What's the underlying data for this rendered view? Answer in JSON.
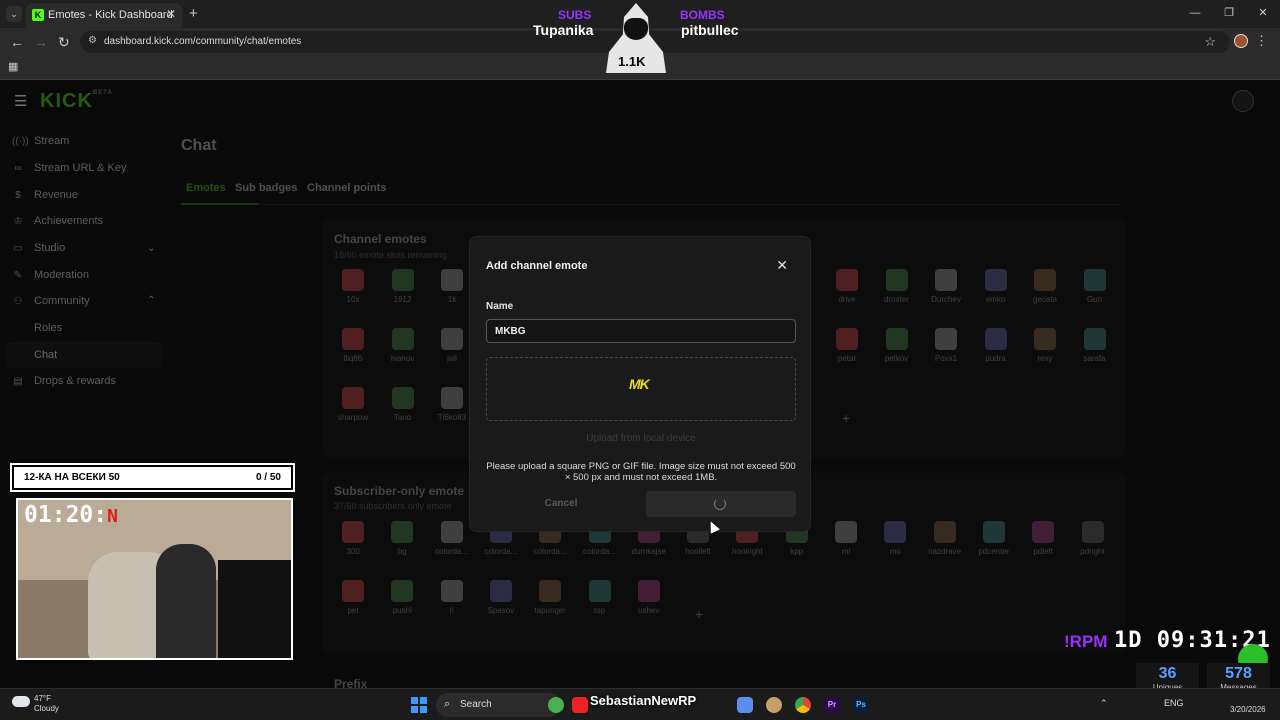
{
  "browser": {
    "tab_title": "Emotes - Kick Dashboard",
    "tab_favicon": "K",
    "url": "dashboard.kick.com/community/chat/emotes"
  },
  "app": {
    "logo": "KICK",
    "logo_badge": "BETA"
  },
  "sidebar": {
    "items": [
      {
        "label": "Stream",
        "icon": "broadcast-icon"
      },
      {
        "label": "Stream URL & Key",
        "icon": "link-icon"
      },
      {
        "label": "Revenue",
        "icon": "dollar-icon"
      },
      {
        "label": "Achievements",
        "icon": "trophy-icon"
      },
      {
        "label": "Studio",
        "icon": "studio-icon"
      },
      {
        "label": "Moderation",
        "icon": "wrench-icon"
      },
      {
        "label": "Community",
        "icon": "community-icon"
      }
    ],
    "community_sub": [
      "Roles",
      "Chat"
    ],
    "drops": "Drops & rewards"
  },
  "main": {
    "title": "Chat",
    "tabs": [
      "Emotes",
      "Sub badges",
      "Channel points"
    ],
    "channel_emotes": {
      "title": "Channel emotes",
      "subtitle": "18/60 emote slots remaining",
      "row1_left": [
        "10x",
        "1912",
        "1k"
      ],
      "row1_right": [
        "drive",
        "droxter",
        "Durchev",
        "emko",
        "gecata",
        "Gun"
      ],
      "row2_left": [
        "lliq86",
        "Ivanov",
        "jail"
      ],
      "row2_right": [
        "petar",
        "petkov",
        "Poxx1",
        "pudra",
        "rexy",
        "sarafa"
      ],
      "row3": [
        "sharpow",
        "Tano",
        "Tl6ko83"
      ]
    },
    "subscriber_emotes": {
      "title": "Subscriber-only emote",
      "subtitle": "37/60 subscribers only emote",
      "row1": [
        "300",
        "bg",
        "colorda...",
        "colorda...",
        "colorda...",
        "colorda...",
        "dumkajse",
        "hoolleft",
        "hoolright",
        "kpp",
        "ml",
        "mo",
        "nazdrave",
        "pdcenter",
        "pdleft",
        "pdright"
      ],
      "row2": [
        "pet",
        "pushl",
        "rl",
        "Spasov",
        "tapunger",
        "top",
        "ushev"
      ]
    },
    "prefix_label": "Prefix"
  },
  "modal": {
    "title": "Add channel emote",
    "name_label": "Name",
    "name_value": "MKBG",
    "preview_text": "MK",
    "upload_link": "Upload from local device",
    "help_text": "Please upload a square PNG or GIF file. Image size must not exceed 500 × 500 px and must not exceed 1MB.",
    "cancel_label": "Cancel"
  },
  "overlay": {
    "subs_label": "SUBS",
    "subs_name": "Tupanika",
    "bombs_label": "BOMBS",
    "bombs_name": "pitbullec",
    "mascot_count": "1.1K",
    "goal_text": "12-КА НА ВСЕКИ 50",
    "goal_count": "0 / 50",
    "timer_h": "01",
    "timer_m": "20",
    "timer_s": "N",
    "rpm": "!RPM",
    "day_label": "1D",
    "clock": "09:31:21",
    "uniques_count": "36",
    "uniques_label": "Uniques",
    "messages_count": "578",
    "messages_label": "Messages"
  },
  "taskbar": {
    "temp": "47°F",
    "weather": "Cloudy",
    "search": "Search",
    "stream_name": "SebastianNewRP",
    "lang": "ENG",
    "date": "3/20/2026"
  },
  "colors": {
    "kick_green": "#53fc18",
    "accent_purple": "#9b30ff"
  }
}
